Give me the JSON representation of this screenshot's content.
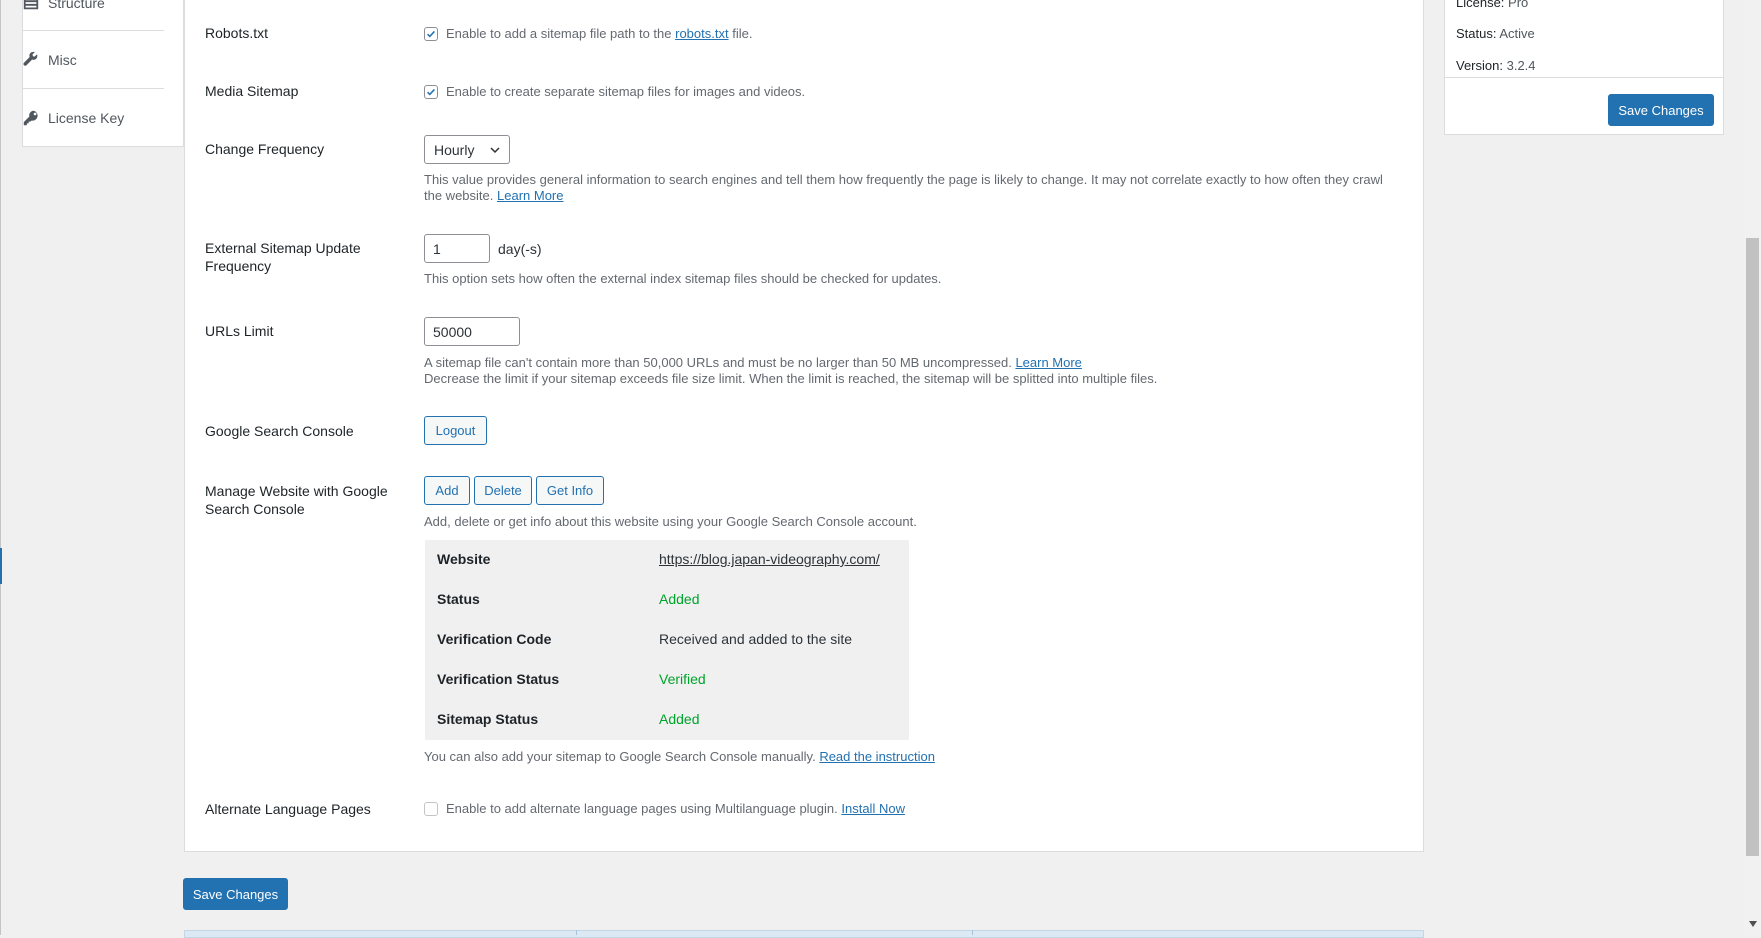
{
  "sidebar": {
    "items": [
      {
        "label": "Structure",
        "icon": "table-icon"
      },
      {
        "label": "Misc",
        "icon": "wrench-icon"
      },
      {
        "label": "License Key",
        "icon": "key-icon"
      }
    ]
  },
  "settings": {
    "robots": {
      "label": "Robots.txt",
      "checked": true,
      "text_before": "Enable to add a sitemap file path to the",
      "link": "robots.txt",
      "text_after": "file."
    },
    "media": {
      "label": "Media Sitemap",
      "checked": true,
      "text": "Enable to create separate sitemap files for images and videos."
    },
    "frequency": {
      "label": "Change Frequency",
      "selected": "Hourly",
      "desc_line1": "This value provides general information to search engines and tell them how frequently the page is likely to change. It may not correlate exactly to how often they crawl",
      "desc_line2": "the website.",
      "learn_more": "Learn More"
    },
    "external": {
      "label_line1": "External Sitemap Update",
      "label_line2": "Frequency",
      "value": "1",
      "unit": "day(-s)",
      "desc": "This option sets how often the external index sitemap files should be checked for updates."
    },
    "urls": {
      "label": "URLs Limit",
      "value": "50000",
      "desc_line1": "A sitemap file can't contain more than 50,000 URLs and must be no larger than 50 MB uncompressed.",
      "learn_more": "Learn More",
      "desc_line2": "Decrease the limit if your sitemap exceeds file size limit. When the limit is reached, the sitemap will be splitted into multiple files."
    },
    "gsc": {
      "label": "Google Search Console",
      "logout": "Logout"
    },
    "manage": {
      "label_line1": "Manage Website with Google",
      "label_line2": "Search Console",
      "buttons": {
        "add": "Add",
        "delete": "Delete",
        "get_info": "Get Info"
      },
      "desc": "Add, delete or get info about this website using your Google Search Console account.",
      "table": [
        {
          "key": "Website",
          "value": "https://blog.japan-videography.com/"
        },
        {
          "key": "Status",
          "value": "Added"
        },
        {
          "key": "Verification Code",
          "value": "Received and added to the site"
        },
        {
          "key": "Verification Status",
          "value": "Verified"
        },
        {
          "key": "Sitemap Status",
          "value": "Added"
        }
      ],
      "manual_text": "You can also add your sitemap to Google Search Console manually.",
      "manual_link": "Read the instruction"
    },
    "alternate": {
      "label": "Alternate Language Pages",
      "checked": false,
      "text": "Enable to add alternate language pages using Multilanguage plugin.",
      "link": "Install Now"
    }
  },
  "save_button": "Save Changes",
  "license_box": {
    "license_label": "License:",
    "license_value": "Pro",
    "status_label": "Status:",
    "status_value": "Active",
    "version_label": "Version:",
    "version_value": "3.2.4",
    "save_button": "Save Changes"
  },
  "colors": {
    "accent": "#2271b1",
    "success": "#00a32a"
  }
}
